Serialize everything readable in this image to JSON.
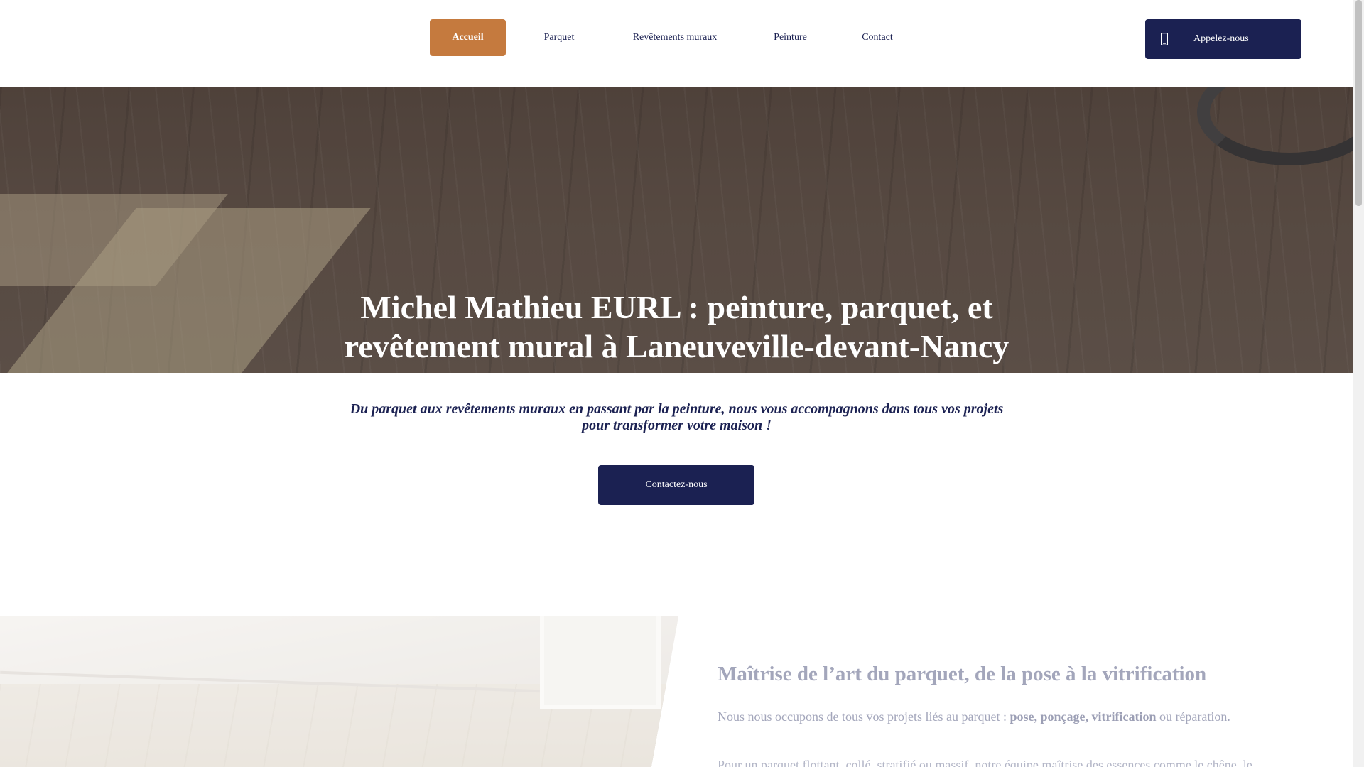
{
  "nav": {
    "items": [
      {
        "label": "Accueil"
      },
      {
        "label": "Parquet"
      },
      {
        "label": "Revêtements muraux"
      },
      {
        "label": "Peinture"
      },
      {
        "label": "Contact"
      }
    ],
    "active": "Accueil",
    "call_button": "Appelez-nous",
    "call_icon": "phone-icon"
  },
  "hero": {
    "title": "Michel Mathieu EURL : peinture, parquet, et revêtement mural à Laneuveville-devant-Nancy"
  },
  "intro": {
    "text": "Du parquet aux revêtements muraux en passant par la peinture, nous vous accompagnons dans tous vos projets pour transformer votre maison !",
    "button": "Contactez-nous"
  },
  "section2": {
    "title": "Maîtrise de l’art du parquet, de la pose à la vitrification",
    "p1_before": "Nous nous occupons de tous vos projets liés au ",
    "p1_link": "parquet",
    "p1_sep": " : ",
    "p1_bold": "pose, ponçage, vitrification",
    "p1_after": " ou réparation.",
    "p2": "Pour un parquet flottant, collé, stratifié ou massif, notre équipe maîtrise des essences comme le chêne, le"
  },
  "colors": {
    "navy": "#1b2152",
    "accent": "#c57a3e",
    "muted_text": "#a3a6bb"
  }
}
